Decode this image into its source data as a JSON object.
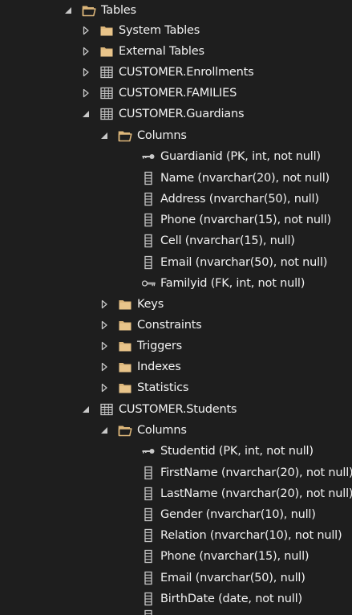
{
  "colors": {
    "background": "#1e1e1e",
    "text": "#f1f1f1",
    "folder": "#dcb67a",
    "table_icon": "#c8c8c8",
    "column_icon": "#c8c8c8",
    "arrow": "#c8c8c8"
  },
  "tree": {
    "tables_label": "Tables",
    "system_tables_label": "System Tables",
    "external_tables_label": "External Tables",
    "enrollments_label": "CUSTOMER.Enrollments",
    "families_label": "CUSTOMER.FAMILIES",
    "guardians": {
      "label": "CUSTOMER.Guardians",
      "columns_label": "Columns",
      "columns": [
        {
          "label": "Guardianid (PK, int, not null)",
          "icon": "primary-key-icon"
        },
        {
          "label": "Name (nvarchar(20), not null)",
          "icon": "column-icon"
        },
        {
          "label": "Address (nvarchar(50), null)",
          "icon": "column-icon"
        },
        {
          "label": "Phone (nvarchar(15), not null)",
          "icon": "column-icon"
        },
        {
          "label": "Cell (nvarchar(15), null)",
          "icon": "column-icon"
        },
        {
          "label": "Email (nvarchar(50), not null)",
          "icon": "column-icon"
        },
        {
          "label": "Familyid (FK, int, not null)",
          "icon": "foreign-key-icon"
        }
      ],
      "keys_label": "Keys",
      "constraints_label": "Constraints",
      "triggers_label": "Triggers",
      "indexes_label": "Indexes",
      "statistics_label": "Statistics"
    },
    "students": {
      "label": "CUSTOMER.Students",
      "columns_label": "Columns",
      "columns": [
        {
          "label": "Studentid (PK, int, not null)",
          "icon": "primary-key-icon"
        },
        {
          "label": "FirstName (nvarchar(20), not null)",
          "icon": "column-icon"
        },
        {
          "label": "LastName (nvarchar(20), not null)",
          "icon": "column-icon"
        },
        {
          "label": "Gender (nvarchar(10), null)",
          "icon": "column-icon"
        },
        {
          "label": "Relation (nvarchar(10), not null)",
          "icon": "column-icon"
        },
        {
          "label": "Phone (nvarchar(15), null)",
          "icon": "column-icon"
        },
        {
          "label": "Email (nvarchar(50), null)",
          "icon": "column-icon"
        },
        {
          "label": "BirthDate (date, not null)",
          "icon": "column-icon"
        }
      ]
    }
  }
}
